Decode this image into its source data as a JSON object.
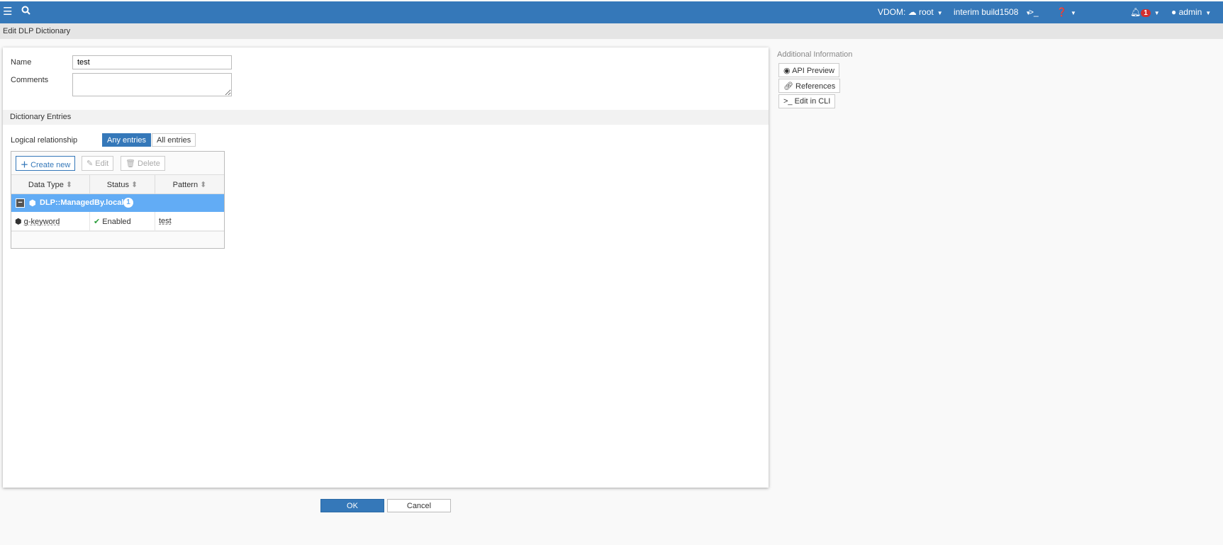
{
  "topbar": {
    "vdom_label": "VDOM:",
    "vdom": "root",
    "build": "interim build1508",
    "notif_count": "1",
    "user": "admin"
  },
  "page_title": "Edit DLP Dictionary",
  "form": {
    "name_label": "Name",
    "name_value": "test",
    "comments_label": "Comments",
    "comments_value": ""
  },
  "entries": {
    "section_title": "Dictionary Entries",
    "logical_label": "Logical relationship",
    "options": [
      "Any entries",
      "All entries"
    ],
    "selected": "Any entries",
    "toolbar": {
      "create": "Create new",
      "edit": "Edit",
      "delete": "Delete"
    },
    "columns": [
      "Data Type",
      "Status",
      "Pattern"
    ],
    "group": {
      "name": "DLP::ManagedBy.local",
      "count": "1"
    },
    "rows": [
      {
        "type": "g-keyword",
        "status": "Enabled",
        "pattern": "test"
      }
    ]
  },
  "side": {
    "title": "Additional Information",
    "api": "API Preview",
    "refs": "References",
    "cli": "Edit in CLI"
  },
  "footer": {
    "ok": "OK",
    "cancel": "Cancel"
  },
  "colors": {
    "brand": "#3578b9",
    "group": "#62acf5",
    "enabled": "#2e9e3e",
    "badge": "#d32f2f"
  }
}
